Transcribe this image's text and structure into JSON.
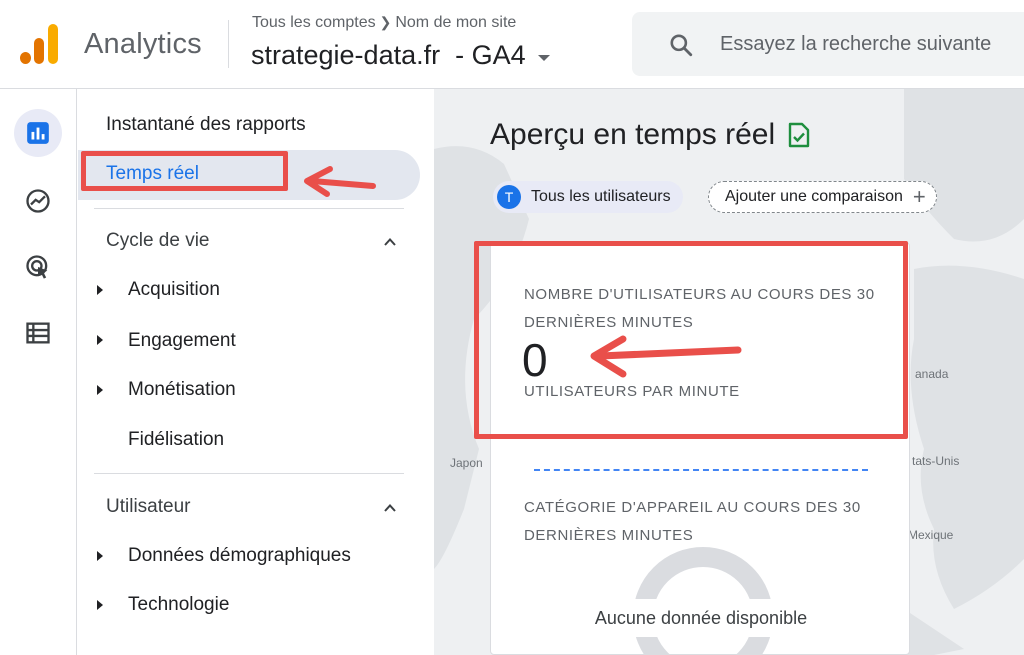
{
  "header": {
    "product": "Analytics",
    "breadcrumb": {
      "account": "Tous les comptes",
      "site": "Nom de mon site"
    },
    "property": "strategie-data.fr  - GA4",
    "search_placeholder": "Essayez la recherche suivante"
  },
  "rail": {
    "icons": [
      "reports-icon",
      "explore-icon",
      "advertising-icon",
      "configure-icon"
    ],
    "active": "reports-icon"
  },
  "nav": {
    "snapshot": "Instantané des rapports",
    "realtime": "Temps réel",
    "lifecycle": {
      "label": "Cycle de vie",
      "items": [
        "Acquisition",
        "Engagement",
        "Monétisation",
        "Fidélisation"
      ]
    },
    "user": {
      "label": "Utilisateur",
      "items": [
        "Données démographiques",
        "Technologie"
      ]
    }
  },
  "main": {
    "title": "Aperçu en temps réel",
    "chip_avatar": "T",
    "chip_label": "Tous les utilisateurs",
    "add_comparison": "Ajouter une comparaison",
    "map_labels": {
      "japon": "Japon",
      "canada": "anada",
      "usa": "tats-Unis",
      "mexico": "Mexique"
    },
    "card": {
      "users_title": "NOMBRE D'UTILISATEURS AU COURS DES 30 DERNIÈRES MINUTES",
      "users_value": "0",
      "users_sub": "UTILISATEURS PAR MINUTE",
      "device_title": "CATÉGORIE D'APPAREIL AU COURS DES 30 DERNIÈRES MINUTES",
      "no_data": "Aucune donnée disponible"
    }
  },
  "colors": {
    "accent": "#1a73e8",
    "annotation": "#e94f4a",
    "logo": [
      "#f9ab00",
      "#e37400"
    ]
  }
}
